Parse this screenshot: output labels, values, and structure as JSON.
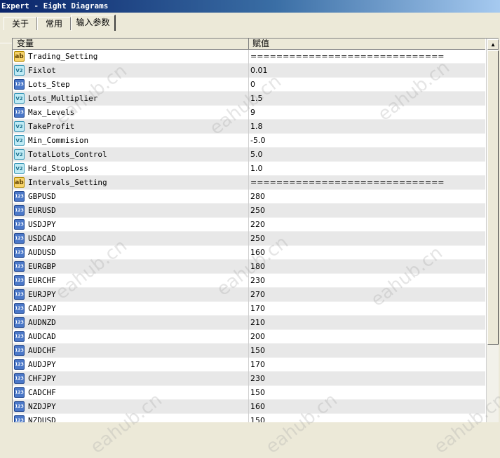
{
  "window": {
    "title": "Expert - Eight Diagrams"
  },
  "tabs": [
    {
      "label": "关于",
      "active": false
    },
    {
      "label": "常用",
      "active": false
    },
    {
      "label": "输入参数",
      "active": true
    }
  ],
  "table": {
    "columns": [
      "变量",
      "赋值"
    ],
    "rows": [
      {
        "icon": "ab",
        "name": "Trading_Setting",
        "value": "=============================="
      },
      {
        "icon": "v",
        "name": "Fixlot",
        "value": "0.01"
      },
      {
        "icon": "n",
        "name": "Lots_Step",
        "value": "0"
      },
      {
        "icon": "v",
        "name": "Lots_Multiplier",
        "value": "1.5"
      },
      {
        "icon": "n",
        "name": "Max_Levels",
        "value": "9"
      },
      {
        "icon": "v",
        "name": "TakeProfit",
        "value": "1.8"
      },
      {
        "icon": "v",
        "name": "Min_Commision",
        "value": "-5.0"
      },
      {
        "icon": "v",
        "name": "TotalLots_Control",
        "value": "5.0"
      },
      {
        "icon": "v",
        "name": "Hard_StopLoss",
        "value": "1.0"
      },
      {
        "icon": "ab",
        "name": "Intervals_Setting",
        "value": "=============================="
      },
      {
        "icon": "n",
        "name": "GBPUSD",
        "value": "280"
      },
      {
        "icon": "n",
        "name": "EURUSD",
        "value": "250"
      },
      {
        "icon": "n",
        "name": "USDJPY",
        "value": "220"
      },
      {
        "icon": "n",
        "name": "USDCAD",
        "value": "250"
      },
      {
        "icon": "n",
        "name": "AUDUSD",
        "value": "160"
      },
      {
        "icon": "n",
        "name": "EURGBP",
        "value": "180"
      },
      {
        "icon": "n",
        "name": "EURCHF",
        "value": "230"
      },
      {
        "icon": "n",
        "name": "EURJPY",
        "value": "270"
      },
      {
        "icon": "n",
        "name": "CADJPY",
        "value": "170"
      },
      {
        "icon": "n",
        "name": "AUDNZD",
        "value": "210"
      },
      {
        "icon": "n",
        "name": "AUDCAD",
        "value": "200"
      },
      {
        "icon": "n",
        "name": "AUDCHF",
        "value": "150"
      },
      {
        "icon": "n",
        "name": "AUDJPY",
        "value": "170"
      },
      {
        "icon": "n",
        "name": "CHFJPY",
        "value": "230"
      },
      {
        "icon": "n",
        "name": "CADCHF",
        "value": "150"
      },
      {
        "icon": "n",
        "name": "NZDJPY",
        "value": "160"
      },
      {
        "icon": "n",
        "name": "NZDUSD",
        "value": "150"
      }
    ]
  },
  "icon_glyphs": {
    "ab": "ab",
    "v": "V2",
    "n": "123"
  },
  "watermark": "eahub.cn",
  "scrollbar": {
    "up_glyph": "▲"
  }
}
